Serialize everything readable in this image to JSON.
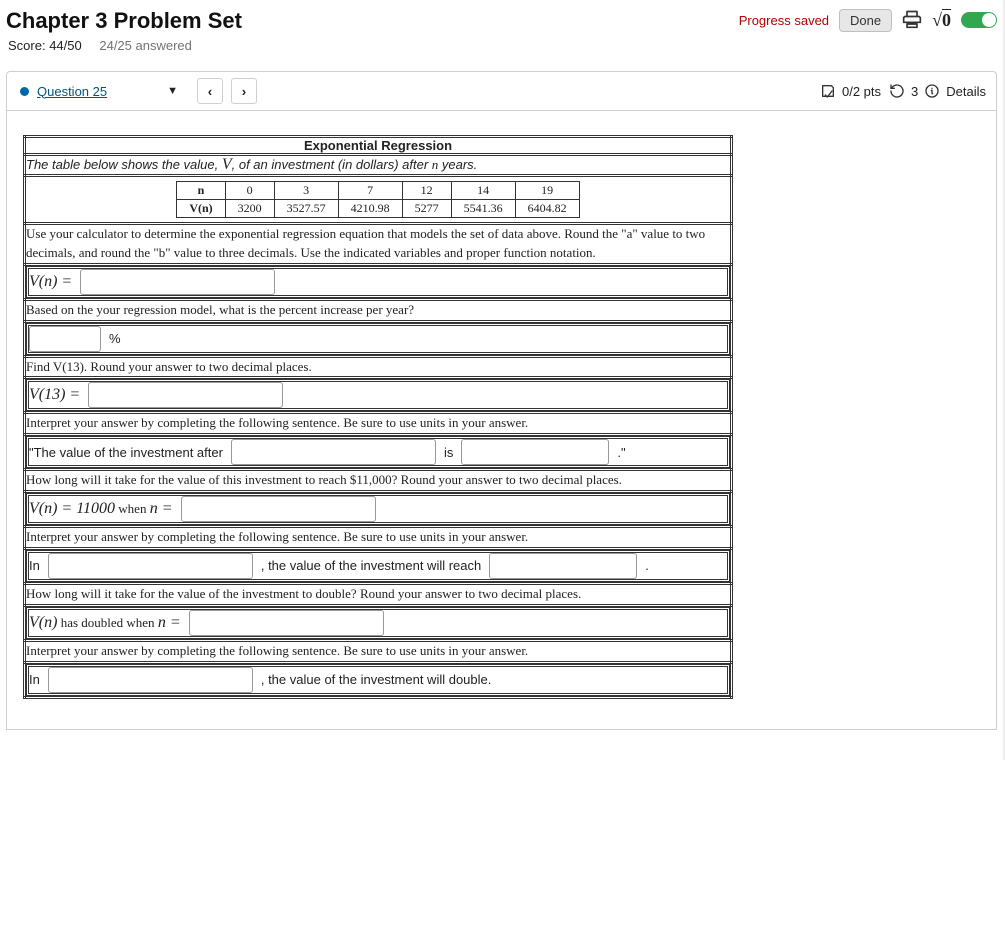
{
  "header": {
    "title": "Chapter 3 Problem Set",
    "progress_label": "Progress saved",
    "done_label": "Done",
    "score_prefix": "Score: ",
    "score": "44/50",
    "answered": "24/25 answered"
  },
  "qbar": {
    "question_label": "Question 25",
    "prev": "‹",
    "next": "›",
    "points": "0/2 pts",
    "retries": "3",
    "details": "Details"
  },
  "problem": {
    "section_title": "Exponential Regression",
    "intro_pre": "The table below shows the value, ",
    "intro_var": "V",
    "intro_mid": ", of an investment (in dollars) after ",
    "intro_nvar": "n",
    "intro_post": " years.",
    "table": {
      "rowlabel_n": "n",
      "rowlabel_v": "V(n)",
      "n": [
        "0",
        "3",
        "7",
        "12",
        "14",
        "19"
      ],
      "v": [
        "3200",
        "3527.57",
        "4210.98",
        "5277",
        "5541.36",
        "6404.82"
      ]
    },
    "instr1": "Use your calculator to determine the exponential regression equation that models the set of data above. Round the \"a\" value to two decimals, and round the \"b\" value to three decimals. Use the indicated variables and proper function notation.",
    "eq1_lhs": "V(n) =",
    "instr2": "Based on the your regression model, what is the percent increase per year?",
    "percent_label": "%",
    "instr3": "Find V(13). Round your answer to two decimal places.",
    "eq3_lhs": "V(13) =",
    "instr4": "Interpret your answer by completing the following sentence. Be sure to use units in your answer.",
    "sent4_pre": "\"The value of the investment after",
    "sent4_mid": "is",
    "sent4_post": ".\"",
    "instr5": "How long will it take for the value of this investment to reach $11,000? Round your answer to two decimal places.",
    "eq5_lhs_a": "V(n) = 11000",
    "eq5_lhs_b": " when ",
    "eq5_lhs_c": "n =",
    "instr6": "Interpret your answer by completing the following sentence. Be sure to use units in your answer.",
    "sent6_pre": "In",
    "sent6_mid": ", the value of the investment will reach",
    "sent6_post": ".",
    "instr7": "How long will it take for the value of the investment to double? Round your answer to two decimal places.",
    "eq7_lhs_a": "V(n)",
    "eq7_lhs_b": " has doubled when ",
    "eq7_lhs_c": "n =",
    "instr8": "Interpret your answer by completing the following sentence. Be sure to use units in your answer.",
    "sent8_pre": "In",
    "sent8_post": ", the value of the investment will double."
  }
}
